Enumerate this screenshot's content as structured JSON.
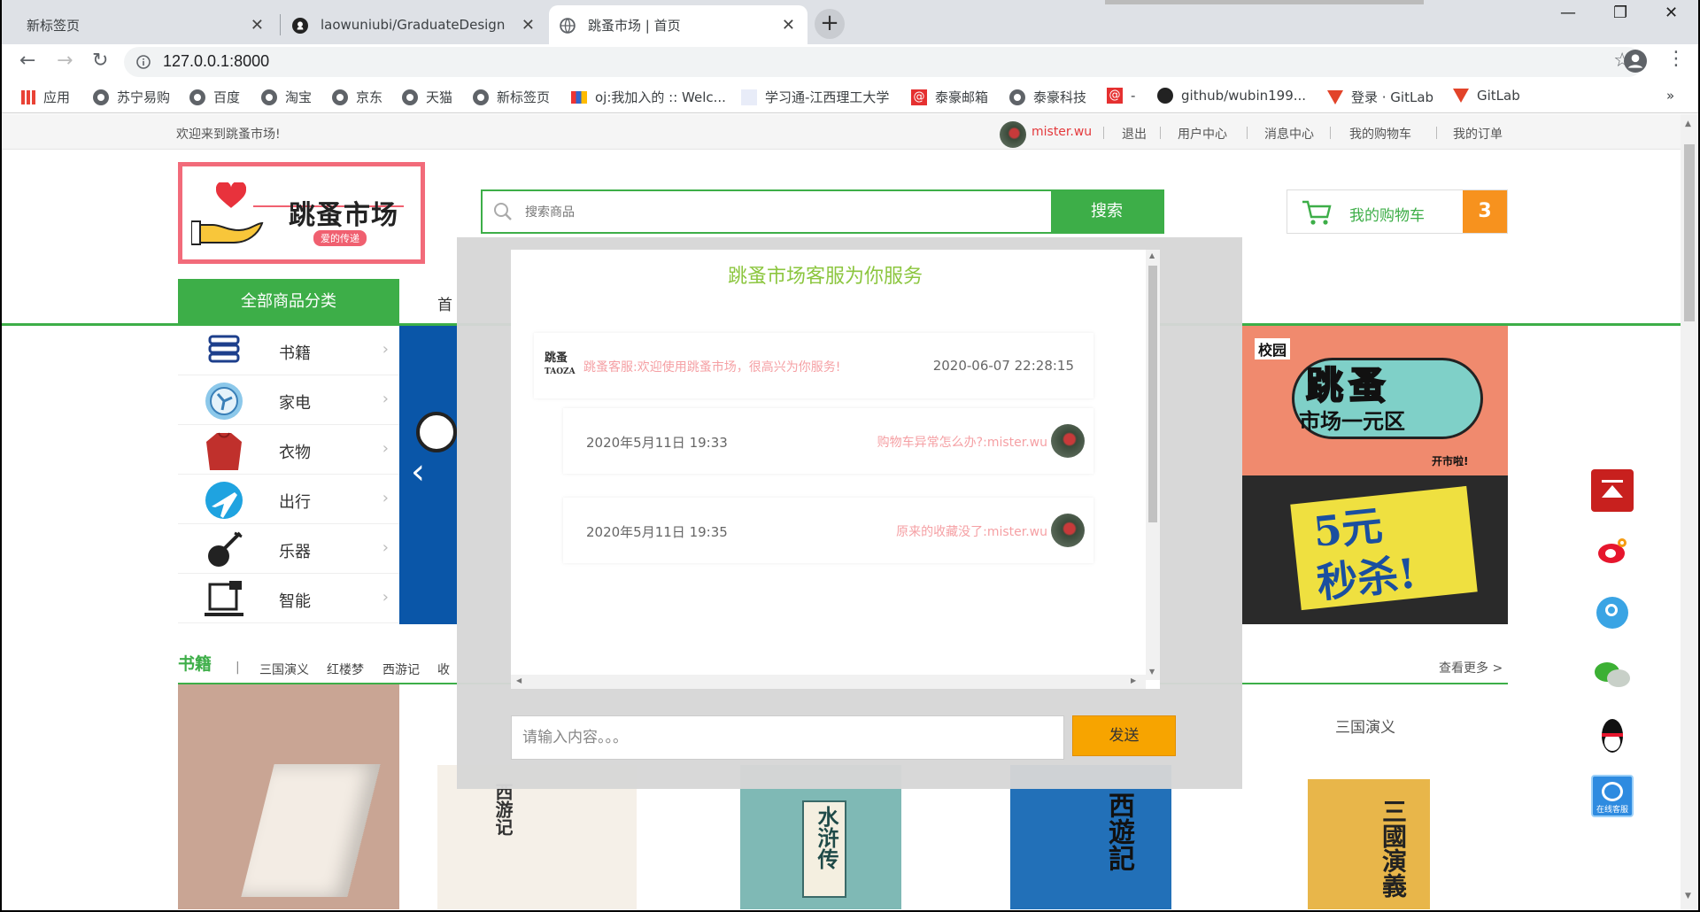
{
  "browser": {
    "tabs": [
      {
        "label": "新标签页",
        "active": false
      },
      {
        "label": "laowuniubi/GraduateDesign",
        "active": false
      },
      {
        "label": "跳蚤市场 | 首页",
        "active": true
      }
    ],
    "url": "127.0.0.1:8000",
    "window_controls": {
      "minimize": "—",
      "restore": "❐",
      "close": "✕"
    },
    "bookmarks": [
      "应用",
      "苏宁易购",
      "百度",
      "淘宝",
      "京东",
      "天猫",
      "新标签页",
      "oj:我加入的 :: Welc...",
      "学习通-江西理工大学",
      "泰豪邮箱",
      "泰豪科技",
      "-",
      "github/wubin199...",
      "登录 · GitLab",
      "GitLab"
    ],
    "bookmarks_more": "»"
  },
  "site": {
    "welcome": "欢迎来到跳蚤市场!",
    "username": "mister.wu",
    "topnav": [
      "退出",
      "用户中心",
      "消息中心",
      "我的购物车",
      "我的订单"
    ],
    "logo_text": "跳蚤市场",
    "logo_badge": "爱的传递",
    "search_placeholder": "搜索商品",
    "search_button": "搜索",
    "cart_label": "我的购物车",
    "cart_count": "3",
    "all_categories": "全部商品分类",
    "home_nav": "首",
    "categories": [
      "书籍",
      "家电",
      "衣物",
      "出行",
      "乐器",
      "智能"
    ],
    "arrow": "›",
    "banner_prev": "‹",
    "promo1": {
      "tag": "校园",
      "title": "跳蚤",
      "subtitle": "市场一元区",
      "footer": "开市啦!"
    },
    "promo2": {
      "line1": "5元",
      "line2": "秒杀!"
    },
    "book_section": "书籍",
    "book_sep": "|",
    "book_subcats": [
      "三国演义",
      "红楼梦",
      "西游记",
      "收"
    ],
    "see_more": "查看更多 >",
    "product_label": "三国演义",
    "product_titles": [
      "西游记",
      "水浒传",
      "西遊記",
      "三國演義"
    ]
  },
  "colors": {
    "brand_green": "#3dae48",
    "orange": "#f7921e",
    "pink": "#f5a0a4",
    "title_green": "#8cc63f"
  },
  "chat": {
    "title": "跳蚤市场客服为你服务",
    "logo": [
      "跳蚤",
      "TAOZA"
    ],
    "messages": [
      {
        "side": "service",
        "text": "跳蚤客服:欢迎使用跳蚤市场，很高兴为你服务!",
        "time": "2020-06-07 22:28:15"
      },
      {
        "side": "user",
        "text": "购物车异常怎么办?:mister.wu",
        "time": "2020年5月11日 19:33"
      },
      {
        "side": "user",
        "text": "原来的收藏没了:mister.wu",
        "time": "2020年5月11日 19:35"
      }
    ],
    "input_placeholder": "请输入内容。。。",
    "send_button": "发送"
  },
  "float_bar": {
    "kefu_label": "在线客服"
  }
}
